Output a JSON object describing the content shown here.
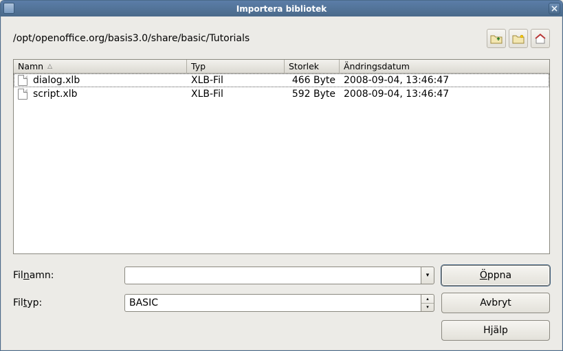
{
  "window": {
    "title": "Importera bibliotek"
  },
  "path": "/opt/openoffice.org/basis3.0/share/basic/Tutorials",
  "columns": {
    "name": "Namn",
    "type": "Typ",
    "size": "Storlek",
    "date": "Ändringsdatum"
  },
  "files": [
    {
      "name": "dialog.xlb",
      "type": "XLB-Fil",
      "size": "466 Byte",
      "date": "2008-09-04, 13:46:47",
      "selected": true
    },
    {
      "name": "script.xlb",
      "type": "XLB-Fil",
      "size": "592 Byte",
      "date": "2008-09-04, 13:46:47",
      "selected": false
    }
  ],
  "form": {
    "filename_label_pre": "Fil",
    "filename_label_ul": "n",
    "filename_label_post": "amn:",
    "filename_value": "",
    "filetype_label_pre": "Fil",
    "filetype_label_ul": "t",
    "filetype_label_post": "yp:",
    "filetype_value": "BASIC"
  },
  "buttons": {
    "open_ul": "Ö",
    "open_post": "ppna",
    "cancel": "Avbryt",
    "help_pre": "H",
    "help_ul": "j",
    "help_post": "älp"
  },
  "icons": {
    "up": "folder-up-icon",
    "newfolder": "new-folder-icon",
    "home": "home-icon"
  }
}
